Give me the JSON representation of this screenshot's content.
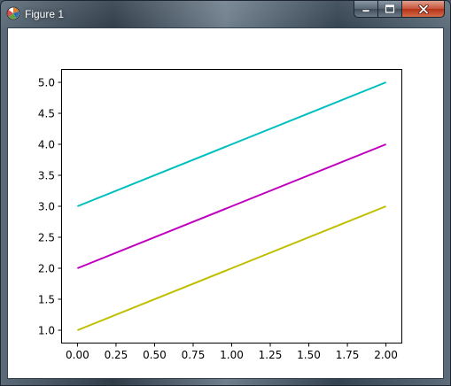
{
  "window": {
    "title": "Figure 1",
    "icon": "matplotlib-icon",
    "controls": {
      "minimize": "minimize-icon",
      "maximize": "maximize-icon",
      "close": "close-icon"
    }
  },
  "colors": {
    "cyan": "#00bfbf",
    "magenta": "#bf00bf",
    "olive": "#bfbf00"
  },
  "chart_data": {
    "type": "line",
    "title": "",
    "xlabel": "",
    "ylabel": "",
    "xlim": [
      -0.1,
      2.1
    ],
    "ylim": [
      0.8,
      5.2
    ],
    "x_ticks": [
      "0.00",
      "0.25",
      "0.50",
      "0.75",
      "1.00",
      "1.25",
      "1.50",
      "1.75",
      "2.00"
    ],
    "y_ticks": [
      "1.0",
      "1.5",
      "2.0",
      "2.5",
      "3.0",
      "3.5",
      "4.0",
      "4.5",
      "5.0"
    ],
    "grid": false,
    "series": [
      {
        "x": [
          0,
          1,
          2
        ],
        "values": [
          1,
          2,
          3
        ],
        "color": "#bfbf00"
      },
      {
        "x": [
          0,
          1,
          2
        ],
        "values": [
          2,
          3,
          4
        ],
        "color": "#bf00bf"
      },
      {
        "x": [
          0,
          1,
          2
        ],
        "values": [
          3,
          4,
          5
        ],
        "color": "#00bfbf"
      }
    ]
  }
}
